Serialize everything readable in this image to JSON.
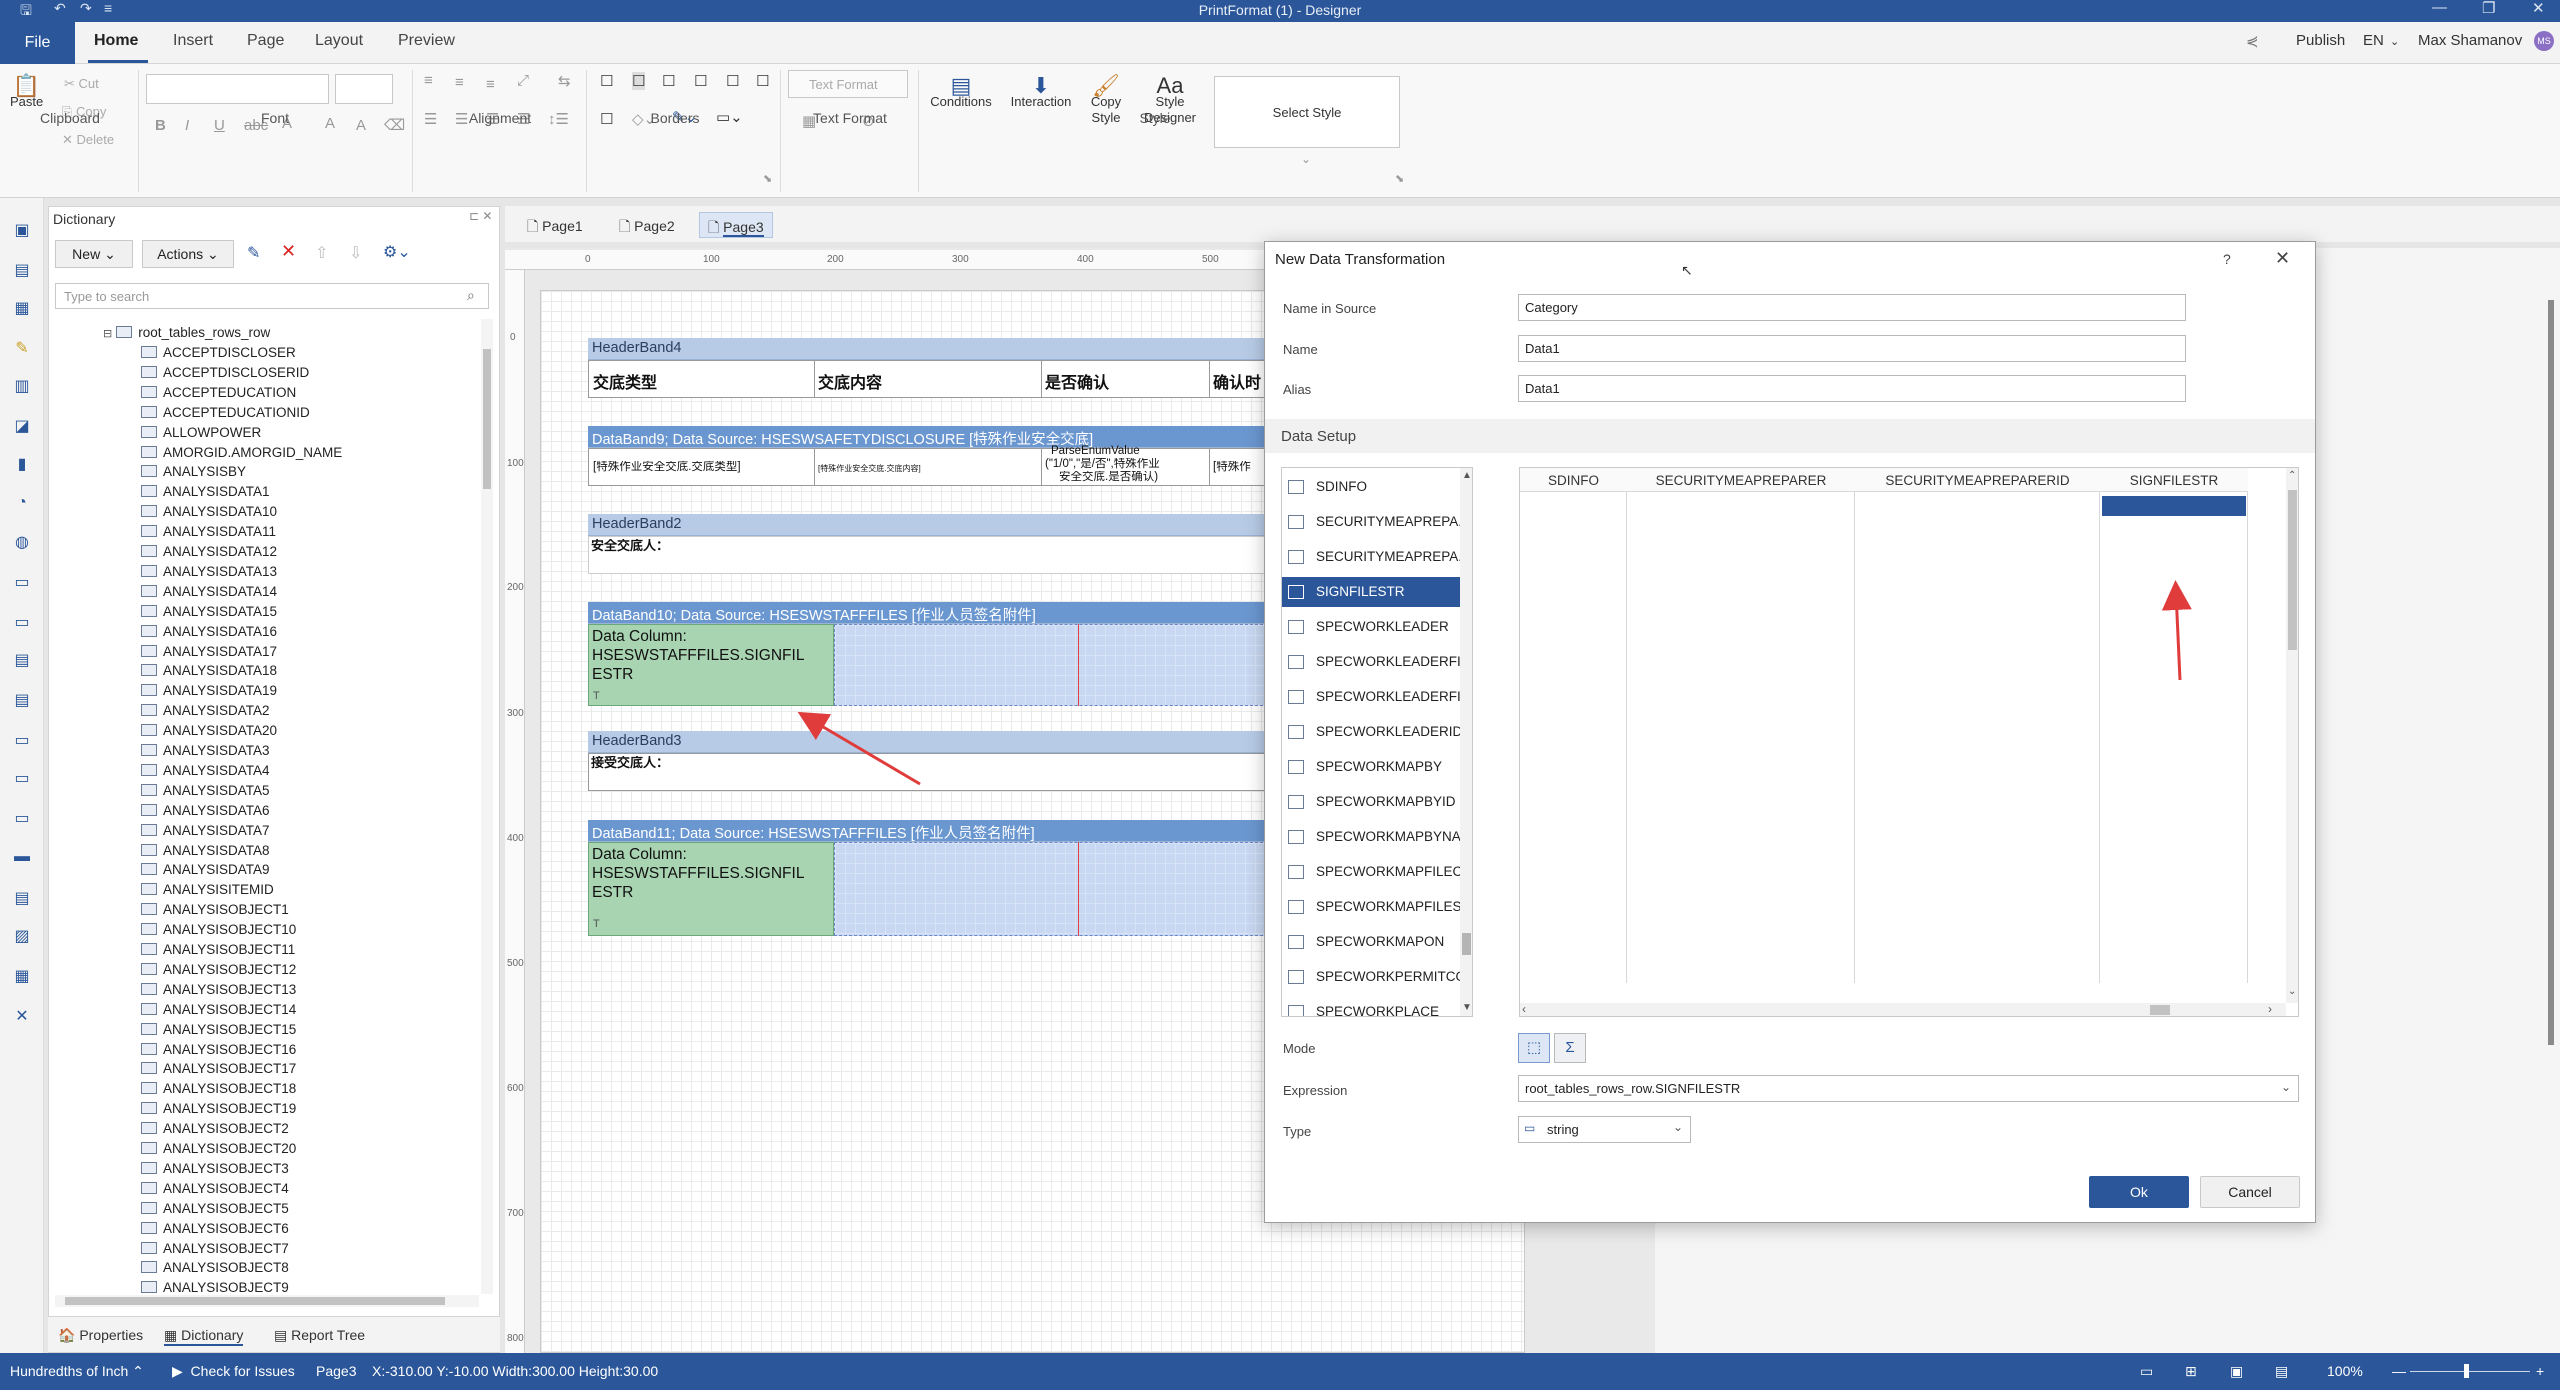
{
  "app": {
    "title": "PrintFormat (1) - Designer"
  },
  "ribbon": {
    "tabs": [
      "File",
      "Home",
      "Insert",
      "Page",
      "Layout",
      "Preview"
    ],
    "publish": "Publish",
    "lang": "EN",
    "user": "Max Shamanov",
    "user_initials": "MS",
    "clipboard": {
      "group": "Clipboard",
      "paste": "Paste",
      "cut": "Cut",
      "copy": "Copy",
      "delete": "Delete"
    },
    "font_group": "Font",
    "alignment_group": "Alignment",
    "borders_group": "Borders",
    "textformat": {
      "group": "Text Format",
      "placeholder": "Text Format"
    },
    "style": {
      "group": "Style",
      "conditions": "Conditions",
      "interaction": "Interaction",
      "copy_style": "Copy Style",
      "style_designer": "Style Designer",
      "select_style": "Select Style"
    }
  },
  "dictionary": {
    "title": "Dictionary",
    "new_label": "New",
    "actions_label": "Actions",
    "search_placeholder": "Type to search",
    "root": "root_tables_rows_row",
    "items": [
      "ACCEPTDISCLOSER",
      "ACCEPTDISCLOSERID",
      "ACCEPTEDUCATION",
      "ACCEPTEDUCATIONID",
      "ALLOWPOWER",
      "AMORGID.AMORGID_NAME",
      "ANALYSISBY",
      "ANALYSISDATA1",
      "ANALYSISDATA10",
      "ANALYSISDATA11",
      "ANALYSISDATA12",
      "ANALYSISDATA13",
      "ANALYSISDATA14",
      "ANALYSISDATA15",
      "ANALYSISDATA16",
      "ANALYSISDATA17",
      "ANALYSISDATA18",
      "ANALYSISDATA19",
      "ANALYSISDATA2",
      "ANALYSISDATA20",
      "ANALYSISDATA3",
      "ANALYSISDATA4",
      "ANALYSISDATA5",
      "ANALYSISDATA6",
      "ANALYSISDATA7",
      "ANALYSISDATA8",
      "ANALYSISDATA9",
      "ANALYSISITEMID",
      "ANALYSISOBJECT1",
      "ANALYSISOBJECT10",
      "ANALYSISOBJECT11",
      "ANALYSISOBJECT12",
      "ANALYSISOBJECT13",
      "ANALYSISOBJECT14",
      "ANALYSISOBJECT15",
      "ANALYSISOBJECT16",
      "ANALYSISOBJECT17",
      "ANALYSISOBJECT18",
      "ANALYSISOBJECT19",
      "ANALYSISOBJECT2",
      "ANALYSISOBJECT20",
      "ANALYSISOBJECT3",
      "ANALYSISOBJECT4",
      "ANALYSISOBJECT5",
      "ANALYSISOBJECT6",
      "ANALYSISOBJECT7",
      "ANALYSISOBJECT8",
      "ANALYSISOBJECT9"
    ],
    "bottom_tabs": [
      "Properties",
      "Dictionary",
      "Report Tree"
    ]
  },
  "pages": [
    "Page1",
    "Page2",
    "Page3"
  ],
  "ruler": {
    "h": [
      "0",
      "100",
      "200",
      "300",
      "400",
      "500"
    ],
    "v": [
      "0",
      "100",
      "200",
      "300",
      "400",
      "500",
      "600",
      "700",
      "800"
    ]
  },
  "report": {
    "headerband4": "HeaderBand4",
    "hb4_cells": [
      "交底类型",
      "交底内容",
      "是否确认",
      "确认时"
    ],
    "databand9": "DataBand9; Data Source: HSESWSAFETYDISCLOSURE [特殊作业安全交底]",
    "db9_cells": [
      "[特殊作业安全交底.交底类型]",
      "[特殊作业安全交底.交底内容]",
      "ParseEnumValue",
      "(\"1/0\",\"是/否\",特殊作业",
      "安全交底.是否确认)",
      "[特殊作"
    ],
    "headerband2": "HeaderBand2",
    "hb2_text": "安全交底人：",
    "databand10": "DataBand10; Data Source: HSESWSTAFFFILES [作业人员签名附件]",
    "green_lines": [
      "Data Column:",
      "HSESWSTAFFFILES.SIGNFIL",
      "ESTR"
    ],
    "headerband3": "HeaderBand3",
    "hb3_text": "接受交底人：",
    "databand11": "DataBand11; Data Source: HSESWSTAFFFILES [作业人员签名附件]"
  },
  "dialog": {
    "title": "New Data Transformation",
    "help": "?",
    "name_in_source_label": "Name in Source",
    "name_in_source": "Category",
    "name_label": "Name",
    "name": "Data1",
    "alias_label": "Alias",
    "alias": "Data1",
    "setup_header": "Data Setup",
    "fields": [
      "SDINFO",
      "SECURITYMEAPREPA...",
      "SECURITYMEAPREPA...",
      "SIGNFILESTR",
      "SPECWORKLEADER",
      "SPECWORKLEADERFI...",
      "SPECWORKLEADERFI...",
      "SPECWORKLEADERID",
      "SPECWORKMAPBY",
      "SPECWORKMAPBYID",
      "SPECWORKMAPBYNA...",
      "SPECWORKMAPFILEC...",
      "SPECWORKMAPFILES",
      "SPECWORKMAPON",
      "SPECWORKPERMITCO...",
      "SPECWORKPLACE"
    ],
    "selected_field": "SIGNFILESTR",
    "columns": [
      "SDINFO",
      "SECURITYMEAPREPARER",
      "SECURITYMEAPREPARERID",
      "SIGNFILESTR"
    ],
    "mode_label": "Mode",
    "expression_label": "Expression",
    "expression": "root_tables_rows_row.SIGNFILESTR",
    "type_label": "Type",
    "type": "string",
    "ok": "Ok",
    "cancel": "Cancel"
  },
  "status": {
    "units": "Hundredths of Inch",
    "check": "Check for Issues",
    "page": "Page3",
    "coords": "X:-310.00  Y:-10.00  Width:300.00  Height:30.00",
    "zoom": "100%"
  },
  "colors": {
    "accent": "#2b579a",
    "annotation_arrow": "#e03c3c",
    "band_header": "#b7cbe6",
    "data_band_header": "#6b97d1",
    "data_column_fill": "#a9d4b2"
  }
}
